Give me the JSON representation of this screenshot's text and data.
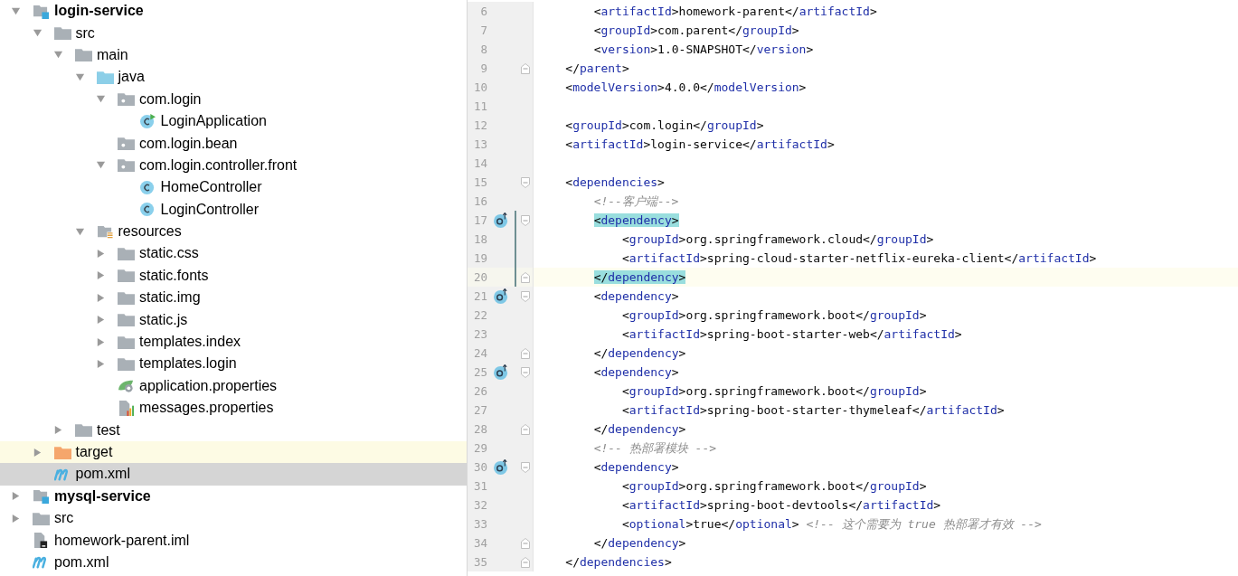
{
  "project_tree": [
    {
      "label": "login-service",
      "kind": "module",
      "bold": true,
      "expanded": true,
      "selected": false,
      "highlighted": false,
      "children": [
        {
          "label": "src",
          "kind": "folder",
          "bold": false,
          "expanded": true,
          "selected": false,
          "highlighted": false,
          "children": [
            {
              "label": "main",
              "kind": "folder",
              "bold": false,
              "expanded": true,
              "selected": false,
              "highlighted": false,
              "children": [
                {
                  "label": "java",
                  "kind": "source-folder",
                  "bold": false,
                  "expanded": true,
                  "selected": false,
                  "highlighted": false,
                  "children": [
                    {
                      "label": "com.login",
                      "kind": "package",
                      "bold": false,
                      "expanded": true,
                      "selected": false,
                      "highlighted": false,
                      "children": [
                        {
                          "label": "LoginApplication",
                          "kind": "spring-class",
                          "bold": false,
                          "selected": false,
                          "highlighted": false
                        }
                      ]
                    },
                    {
                      "label": "com.login.bean",
                      "kind": "package",
                      "bold": false,
                      "selected": false,
                      "highlighted": false
                    },
                    {
                      "label": "com.login.controller.front",
                      "kind": "package",
                      "bold": false,
                      "expanded": true,
                      "selected": false,
                      "highlighted": false,
                      "children": [
                        {
                          "label": "HomeController",
                          "kind": "class",
                          "bold": false,
                          "selected": false,
                          "highlighted": false
                        },
                        {
                          "label": "LoginController",
                          "kind": "class",
                          "bold": false,
                          "selected": false,
                          "highlighted": false
                        }
                      ]
                    }
                  ]
                },
                {
                  "label": "resources",
                  "kind": "resources-folder",
                  "bold": false,
                  "expanded": true,
                  "selected": false,
                  "highlighted": false,
                  "children": [
                    {
                      "label": "static.css",
                      "kind": "folder",
                      "bold": false,
                      "expanded": false,
                      "selected": false,
                      "highlighted": false
                    },
                    {
                      "label": "static.fonts",
                      "kind": "folder",
                      "bold": false,
                      "expanded": false,
                      "selected": false,
                      "highlighted": false
                    },
                    {
                      "label": "static.img",
                      "kind": "folder",
                      "bold": false,
                      "expanded": false,
                      "selected": false,
                      "highlighted": false
                    },
                    {
                      "label": "static.js",
                      "kind": "folder",
                      "bold": false,
                      "expanded": false,
                      "selected": false,
                      "highlighted": false
                    },
                    {
                      "label": "templates.index",
                      "kind": "folder",
                      "bold": false,
                      "expanded": false,
                      "selected": false,
                      "highlighted": false
                    },
                    {
                      "label": "templates.login",
                      "kind": "folder",
                      "bold": false,
                      "expanded": false,
                      "selected": false,
                      "highlighted": false
                    },
                    {
                      "label": "application.properties",
                      "kind": "spring-properties",
                      "bold": false,
                      "selected": false,
                      "highlighted": false
                    },
                    {
                      "label": "messages.properties",
                      "kind": "properties",
                      "bold": false,
                      "selected": false,
                      "highlighted": false
                    }
                  ]
                }
              ]
            },
            {
              "label": "test",
              "kind": "folder",
              "bold": false,
              "expanded": false,
              "selected": false,
              "highlighted": false
            }
          ]
        },
        {
          "label": "target",
          "kind": "excluded-folder",
          "bold": false,
          "expanded": false,
          "selected": false,
          "highlighted": true
        },
        {
          "label": "pom.xml",
          "kind": "maven",
          "bold": false,
          "selected": true,
          "highlighted": false
        }
      ]
    },
    {
      "label": "mysql-service",
      "kind": "module",
      "bold": true,
      "expanded": false,
      "selected": false,
      "highlighted": false
    },
    {
      "label": "src",
      "kind": "folder",
      "bold": false,
      "expanded": false,
      "selected": false,
      "highlighted": false
    },
    {
      "label": "homework-parent.iml",
      "kind": "iml",
      "bold": false,
      "selected": false,
      "highlighted": false
    },
    {
      "label": "pom.xml",
      "kind": "maven",
      "bold": false,
      "selected": false,
      "highlighted": false
    }
  ],
  "editor": {
    "lines": [
      {
        "number": "6",
        "text": "        <artifactId>homework-parent</artifactId>"
      },
      {
        "number": "7",
        "text": "        <groupId>com.parent</groupId>"
      },
      {
        "number": "8",
        "text": "        <version>1.0-SNAPSHOT</version>"
      },
      {
        "number": "9",
        "text": "    </parent>",
        "fold_end": true
      },
      {
        "number": "10",
        "text": "    <modelVersion>4.0.0</modelVersion>"
      },
      {
        "number": "11"
      },
      {
        "number": "12",
        "text": "    <groupId>com.login</groupId>"
      },
      {
        "number": "13",
        "text": "    <artifactId>login-service</artifactId>"
      },
      {
        "number": "14"
      },
      {
        "number": "15",
        "text": "    <dependencies>",
        "fold_start": true
      },
      {
        "number": "16",
        "text": "        <!--客户端-->"
      },
      {
        "number": "17",
        "text": "        <dependency>",
        "fold_start": true,
        "gutter_icon": true,
        "changed": true,
        "brace_match": true
      },
      {
        "number": "18",
        "text": "            <groupId>org.springframework.cloud</groupId>",
        "changed": true
      },
      {
        "number": "19",
        "text": "            <artifactId>spring-cloud-starter-netflix-eureka-client</artifactId>",
        "changed": true
      },
      {
        "number": "20",
        "text": "        </dependency>",
        "fold_end": true,
        "changed": true,
        "brace_match": true,
        "current": true
      },
      {
        "number": "21",
        "text": "        <dependency>",
        "fold_start": true,
        "gutter_icon": true
      },
      {
        "number": "22",
        "text": "            <groupId>org.springframework.boot</groupId>"
      },
      {
        "number": "23",
        "text": "            <artifactId>spring-boot-starter-web</artifactId>"
      },
      {
        "number": "24",
        "text": "        </dependency>",
        "fold_end": true
      },
      {
        "number": "25",
        "text": "        <dependency>",
        "fold_start": true,
        "gutter_icon": true
      },
      {
        "number": "26",
        "text": "            <groupId>org.springframework.boot</groupId>"
      },
      {
        "number": "27",
        "text": "            <artifactId>spring-boot-starter-thymeleaf</artifactId>"
      },
      {
        "number": "28",
        "text": "        </dependency>",
        "fold_end": true
      },
      {
        "number": "29",
        "text": "        <!-- 热部署模块 -->"
      },
      {
        "number": "30",
        "text": "        <dependency>",
        "fold_start": true,
        "gutter_icon": true
      },
      {
        "number": "31",
        "text": "            <groupId>org.springframework.boot</groupId>"
      },
      {
        "number": "32",
        "text": "            <artifactId>spring-boot-devtools</artifactId>"
      },
      {
        "number": "33",
        "text": "            <optional>true</optional> <!-- 这个需要为 true 热部署才有效 -->"
      },
      {
        "number": "34",
        "text": "        </dependency>",
        "fold_end": true
      },
      {
        "number": "35",
        "text": "    </dependencies>",
        "fold_end": true
      }
    ]
  }
}
